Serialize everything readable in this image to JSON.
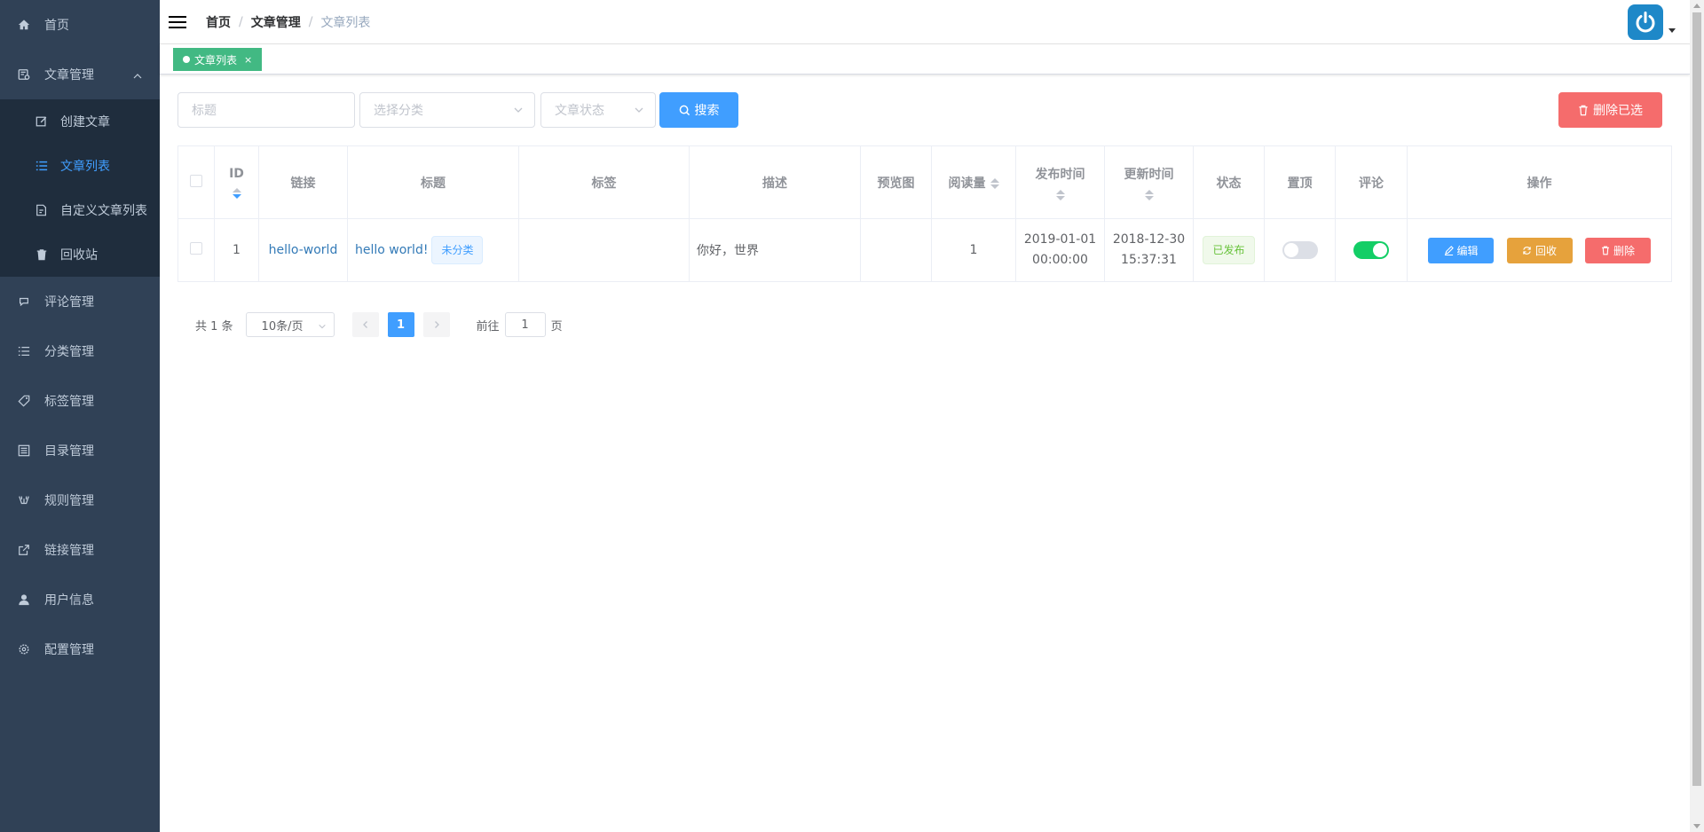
{
  "colors": {
    "sidebar_bg": "#304156",
    "submenu_bg": "#1f2d3d",
    "active": "#409eff",
    "tag_green": "#42b983",
    "danger": "#f56c6c",
    "warning": "#e6a23c",
    "switch_on": "#13ce66"
  },
  "sidebar": {
    "home": {
      "label": "首页",
      "icon": "home-icon"
    },
    "article": {
      "label": "文章管理",
      "icon": "article-icon",
      "expanded": true
    },
    "sub_items": [
      {
        "label": "创建文章",
        "icon": "edit-icon"
      },
      {
        "label": "文章列表",
        "icon": "list-icon",
        "active": true
      },
      {
        "label": "自定义文章列表",
        "icon": "document-icon"
      },
      {
        "label": "回收站",
        "icon": "trash-icon"
      }
    ],
    "items": [
      {
        "label": "评论管理",
        "icon": "comment-icon"
      },
      {
        "label": "分类管理",
        "icon": "list-icon"
      },
      {
        "label": "标签管理",
        "icon": "tag-icon"
      },
      {
        "label": "目录管理",
        "icon": "catalog-icon"
      },
      {
        "label": "规则管理",
        "icon": "rule-icon"
      },
      {
        "label": "链接管理",
        "icon": "external-link-icon"
      },
      {
        "label": "用户信息",
        "icon": "user-icon"
      },
      {
        "label": "配置管理",
        "icon": "settings-icon"
      }
    ]
  },
  "navbar": {
    "breadcrumb": [
      "首页",
      "文章管理",
      "文章列表"
    ],
    "separator": "/"
  },
  "tagsview": {
    "tags": [
      {
        "label": "文章列表",
        "close": "×",
        "active": true
      }
    ]
  },
  "filter": {
    "title_placeholder": "标题",
    "category_placeholder": "选择分类",
    "status_placeholder": "文章状态",
    "search_label": "搜索",
    "delete_selected_label": "删除已选"
  },
  "table": {
    "columns": [
      "ID",
      "链接",
      "标题",
      "标签",
      "描述",
      "预览图",
      "阅读量",
      "发布时间",
      "更新时间",
      "状态",
      "置顶",
      "评论",
      "操作"
    ],
    "rows": [
      {
        "id": "1",
        "link": "hello-world",
        "title": "hello world!",
        "category": "未分类",
        "tags": "",
        "description": "你好，世界",
        "preview": "",
        "views": "1",
        "published_date": "2019-01-01",
        "published_time": "00:00:00",
        "updated_date": "2018-12-30",
        "updated_time": "15:37:31",
        "status": "已发布",
        "top": false,
        "comments_enabled": true,
        "actions": {
          "edit": "编辑",
          "recycle": "回收",
          "delete": "删除"
        }
      }
    ]
  },
  "pagination": {
    "total_text": "共 1 条",
    "page_size": "10条/页",
    "current_page": "1",
    "goto_label": "前往",
    "goto_value": "1",
    "page_suffix": "页"
  }
}
